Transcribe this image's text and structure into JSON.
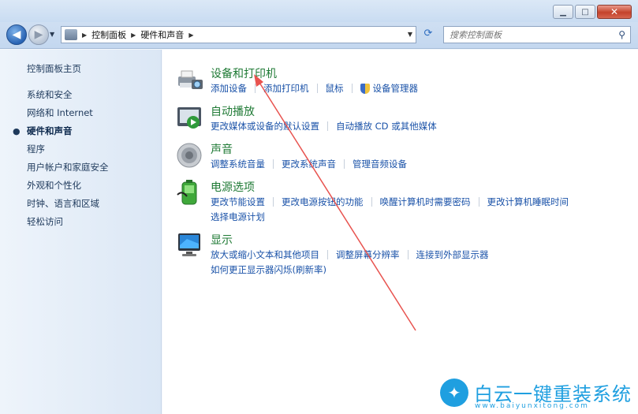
{
  "window": {
    "minimize_glyph": "▁",
    "maximize_glyph": "□",
    "close_glyph": "✕"
  },
  "address_bar": {
    "crumbs": [
      "控制面板",
      "硬件和声音"
    ]
  },
  "search": {
    "placeholder": "搜索控制面板"
  },
  "sidebar": {
    "items": [
      {
        "label": "控制面板主页",
        "active": false
      },
      {
        "label": "系统和安全",
        "active": false
      },
      {
        "label": "网络和 Internet",
        "active": false
      },
      {
        "label": "硬件和声音",
        "active": true
      },
      {
        "label": "程序",
        "active": false
      },
      {
        "label": "用户帐户和家庭安全",
        "active": false
      },
      {
        "label": "外观和个性化",
        "active": false
      },
      {
        "label": "时钟、语言和区域",
        "active": false
      },
      {
        "label": "轻松访问",
        "active": false
      }
    ]
  },
  "categories": [
    {
      "title": "设备和打印机",
      "icon": "printer-icon",
      "links": [
        "添加设备",
        "添加打印机",
        "鼠标",
        "设备管理器"
      ]
    },
    {
      "title": "自动播放",
      "icon": "autoplay-icon",
      "links": [
        "更改媒体或设备的默认设置",
        "自动播放 CD 或其他媒体"
      ]
    },
    {
      "title": "声音",
      "icon": "speaker-icon",
      "links": [
        "调整系统音量",
        "更改系统声音",
        "管理音频设备"
      ]
    },
    {
      "title": "电源选项",
      "icon": "battery-icon",
      "links": [
        "更改节能设置",
        "更改电源按钮的功能",
        "唤醒计算机时需要密码",
        "更改计算机睡眠时间"
      ],
      "links2": [
        "选择电源计划"
      ]
    },
    {
      "title": "显示",
      "icon": "monitor-icon",
      "links": [
        "放大或缩小文本和其他项目",
        "调整屏幕分辨率",
        "连接到外部显示器"
      ],
      "links2": [
        "如何更正显示器闪烁(刷新率)"
      ]
    }
  ],
  "watermark": {
    "text": "白云一键重装系统",
    "url": "www.baiyunxitong.com"
  },
  "colors": {
    "link": "#1a52a8",
    "category_title": "#1f7a35",
    "annotation_arrow": "#e8534f",
    "watermark": "#1f9fe0"
  }
}
